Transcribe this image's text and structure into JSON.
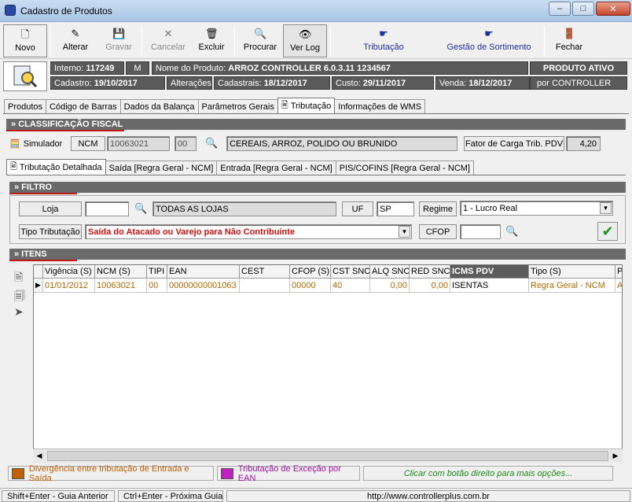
{
  "window": {
    "title": "Cadastro de Produtos",
    "minimize": "–",
    "maximize": "□",
    "close": "✕"
  },
  "toolbar": {
    "novo": "Novo",
    "alterar": "Alterar",
    "gravar": "Gravar",
    "cancelar": "Cancelar",
    "excluir": "Excluir",
    "procurar": "Procurar",
    "ver_log": "Ver Log",
    "tributacao": "Tributação",
    "gestao_sortimento": "Gestão de Sortimento",
    "fechar": "Fechar"
  },
  "product": {
    "interno_label": "Interno:",
    "interno_value": "117249",
    "m_flag": "M",
    "nome_label": "Nome do Produto:",
    "nome_value": "ARROZ  CONTROLLER 6.0.3.11 1234567",
    "status": "PRODUTO ATIVO",
    "cadastro_label": "Cadastro:",
    "cadastro_value": "19/10/2017",
    "alteracoes_label": "Alterações",
    "cadastrais_label": "Cadastrais:",
    "cadastrais_value": "18/12/2017",
    "custo_label": "Custo:",
    "custo_value": "29/11/2017",
    "venda_label": "Venda:",
    "venda_value": "18/12/2017",
    "por_label": "por CONTROLLER"
  },
  "main_tabs": [
    "Produtos",
    "Código de Barras",
    "Dados da Balança",
    "Parâmetros Gerais",
    "Tributação",
    "Informações de WMS"
  ],
  "classificacao": {
    "header": "» CLASSIFICAÇÃO FISCAL",
    "simulador": "Simulador",
    "ncm_label": "NCM",
    "ncm_value": "10063021",
    "ex_value": "00",
    "descricao": "CEREAIS, ARROZ, POLIDO OU BRUNIDO",
    "fator_label": "Fator de Carga Trib. PDV",
    "fator_value": "4,20"
  },
  "sub_tabs": [
    "Tributação Detalhada",
    "Saída [Regra Geral - NCM]",
    "Entrada [Regra Geral - NCM]",
    "PIS/COFINS [Regra Geral - NCM]"
  ],
  "filtro": {
    "header": "» FILTRO",
    "loja_label": "Loja",
    "loja_value": "",
    "loja_desc": "TODAS AS LOJAS",
    "uf_label": "UF",
    "uf_value": "SP",
    "regime_label": "Regime",
    "regime_value": "1 - Lucro Real",
    "tipo_trib_label": "Tipo Tributação",
    "tipo_trib_value": "Saída do Atacado ou Varejo para Não Contribuinte",
    "cfop_label": "CFOP",
    "cfop_value": ""
  },
  "itens": {
    "header": "» ITENS",
    "columns": [
      "Vigência (S)",
      "NCM (S)",
      "TIPI",
      "EAN",
      "CEST",
      "CFOP (S)",
      "CST SNC",
      "ALQ SNC",
      "RED SNC",
      "ICMS PDV",
      "Tipo (S)",
      "P"
    ],
    "row": [
      "01/01/2012",
      "10063021",
      "00",
      "00000000001063",
      "",
      "00000",
      "40",
      "0,00",
      "0,00",
      "ISENTAS",
      "Regra Geral - NCM",
      "Al"
    ]
  },
  "legend": {
    "divergencia": "Divergência entre tributação de Entrada e Saída",
    "divergencia_color": "#c06000",
    "excecao": "Tributação de Exceção por EAN",
    "excecao_color": "#c020c0",
    "hint": "Clicar com botão direito para mais opções..."
  },
  "status": {
    "shift": "Shift+Enter - Guia Anterior",
    "ctrl": "Ctrl+Enter - Próxima Guia",
    "url": "http://www.controllerplus.com.br"
  }
}
